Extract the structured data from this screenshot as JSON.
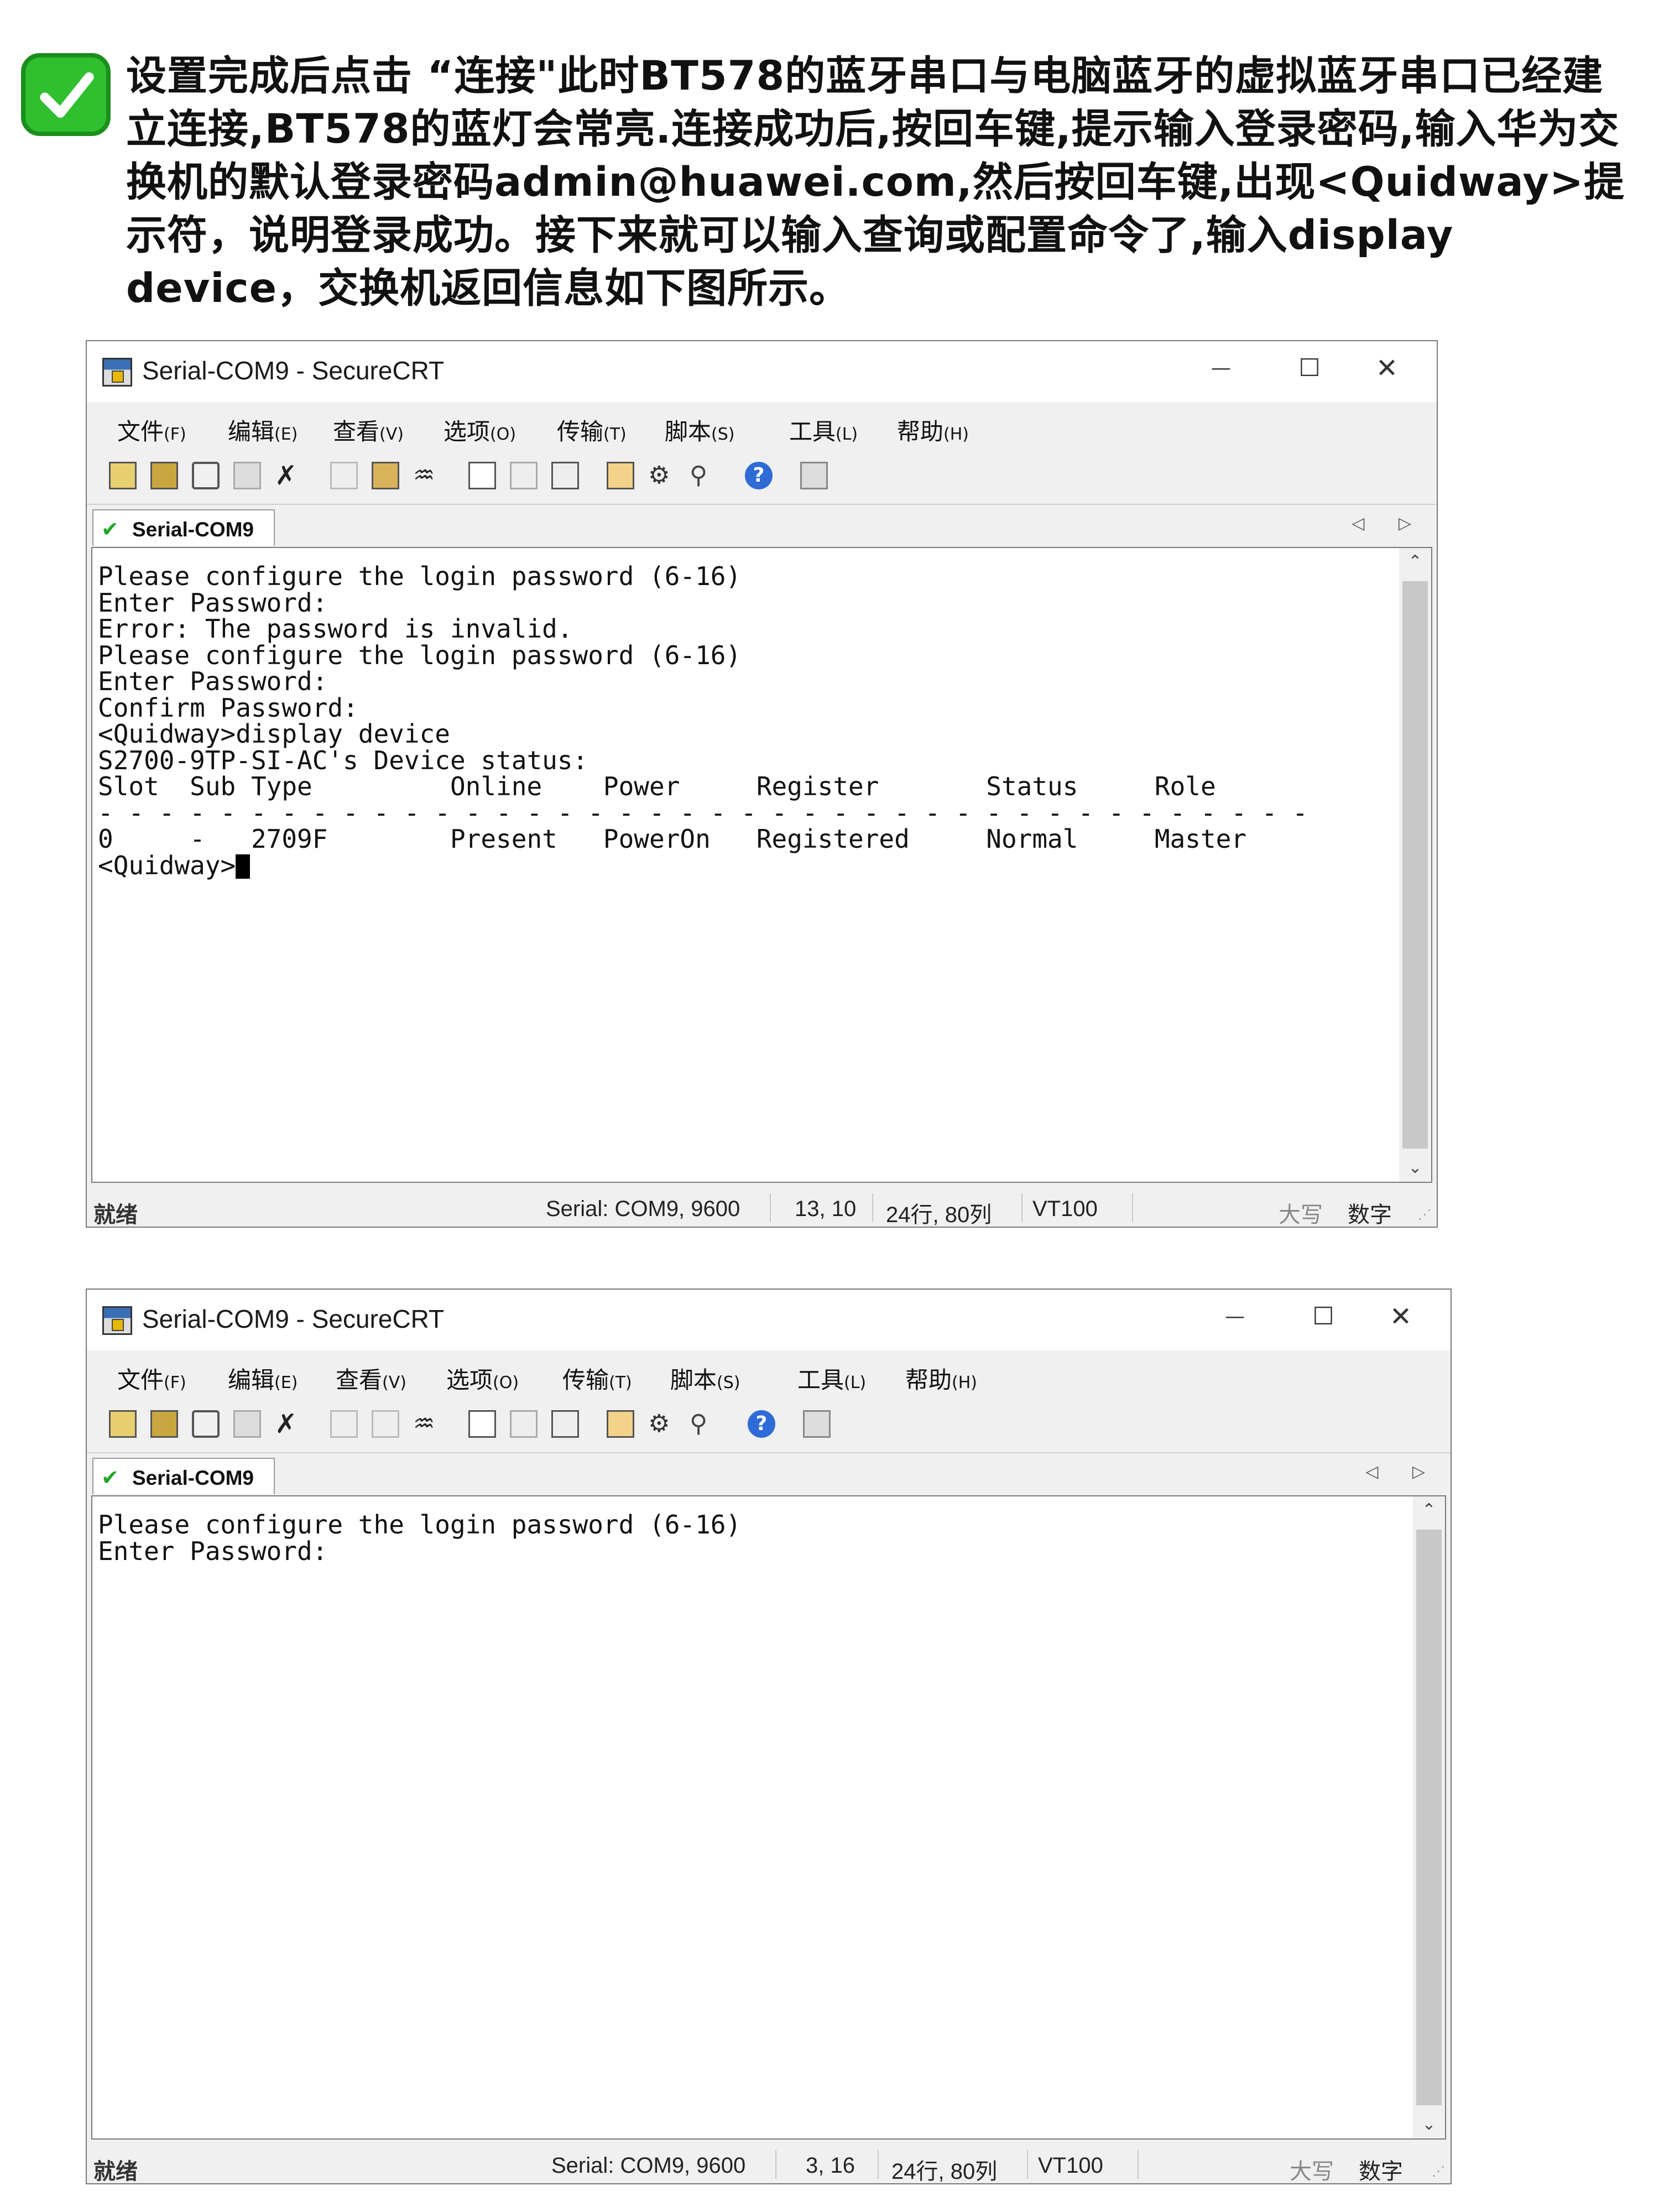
{
  "intro": {
    "text": "设置完成后点击 “连接\"此时BT578的蓝牙串口与电脑蓝牙的虚拟蓝牙串口已经建立连接,BT578的蓝灯会常亮.连接成功后,按回车键,提示输入登录密码,输入华为交换机的默认登录密码admin@huawei.com,然后按回车键,出现<Quidway>提示符，说明登录成功。接下来就可以输入查询或配置命令了,输入display device，交换机返回信息如下图所示。",
    "icon": "check-mark-icon",
    "icon_color": "#2fbf2f"
  },
  "windows": [
    {
      "title": "Serial-COM9 - SecureCRT",
      "controls": {
        "minimize": "—",
        "maximize": "☐",
        "close": "✕"
      },
      "menu": [
        {
          "label": "文件",
          "key": "(F)"
        },
        {
          "label": "编辑",
          "key": "(E)"
        },
        {
          "label": "查看",
          "key": "(V)"
        },
        {
          "label": "选项",
          "key": "(O)"
        },
        {
          "label": "传输",
          "key": "(T)"
        },
        {
          "label": "脚本",
          "key": "(S)"
        },
        {
          "label": "工具",
          "key": "(L)"
        },
        {
          "label": "帮助",
          "key": "(H)"
        }
      ],
      "tab": {
        "label": "Serial-COM9",
        "check": "✔"
      },
      "tab_arrows": "◁ ▷",
      "terminal_lines": "Please configure the login password (6-16)\nEnter Password:\nError: The password is invalid.\nPlease configure the login password (6-16)\nEnter Password:\nConfirm Password:\n<Quidway>display device\nS2700-9TP-SI-AC's Device status:\nSlot  Sub Type         Online    Power     Register       Status     Role\n- - - - - - - - - - - - - - - - - - - - - - - - - - - - - - - - - - - - - - - -\n0     -   2709F        Present   PowerOn   Registered     Normal     Master\n<Quidway>",
      "status": {
        "ready": "就绪",
        "serial": "Serial: COM9, 9600",
        "position": "13,  10",
        "size": "24行, 80列",
        "emulation": "VT100",
        "caps": "大写",
        "num": "数字"
      }
    },
    {
      "title": "Serial-COM9 - SecureCRT",
      "controls": {
        "minimize": "—",
        "maximize": "☐",
        "close": "✕"
      },
      "menu": [
        {
          "label": "文件",
          "key": "(F)"
        },
        {
          "label": "编辑",
          "key": "(E)"
        },
        {
          "label": "查看",
          "key": "(V)"
        },
        {
          "label": "选项",
          "key": "(O)"
        },
        {
          "label": "传输",
          "key": "(T)"
        },
        {
          "label": "脚本",
          "key": "(S)"
        },
        {
          "label": "工具",
          "key": "(L)"
        },
        {
          "label": "帮助",
          "key": "(H)"
        }
      ],
      "tab": {
        "label": "Serial-COM9",
        "check": "✔"
      },
      "tab_arrows": "◁ ▷",
      "terminal_lines": "Please configure the login password (6-16)\nEnter Password:",
      "status": {
        "ready": "就绪",
        "serial": "Serial: COM9, 9600",
        "position": "3,  16",
        "size": "24行, 80列",
        "emulation": "VT100",
        "caps": "大写",
        "num": "数字"
      }
    }
  ]
}
